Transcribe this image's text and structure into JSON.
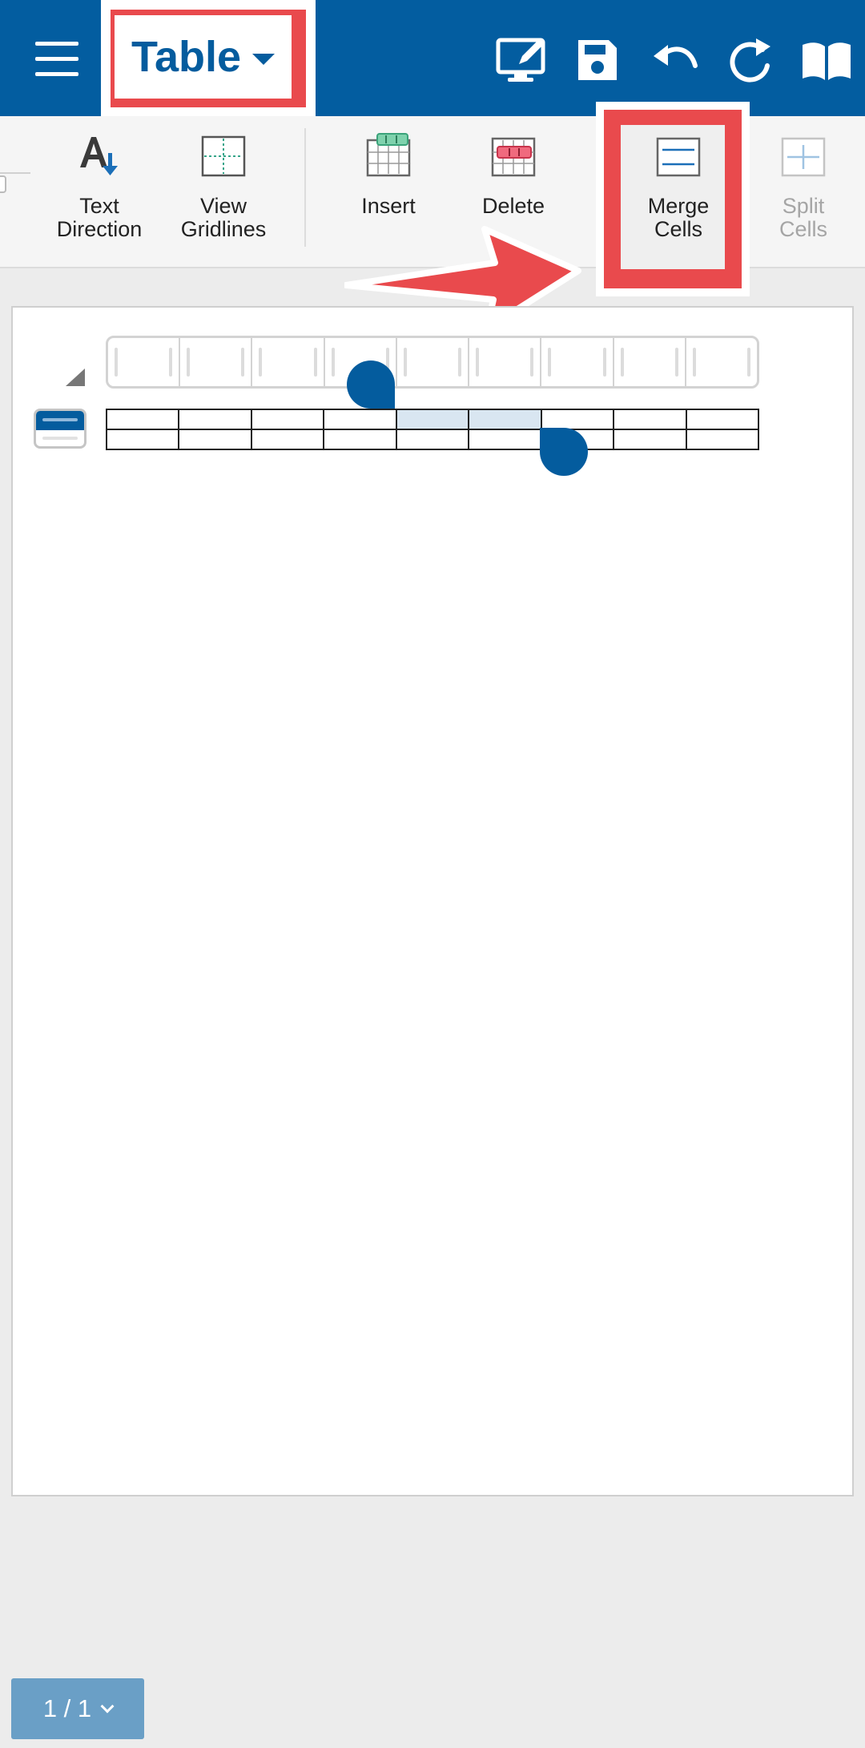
{
  "app_bar": {
    "menu_icon": "hamburger-menu-icon",
    "menu_title": "Table",
    "actions": [
      {
        "name": "present-edit-icon"
      },
      {
        "name": "save-icon"
      },
      {
        "name": "undo-icon"
      },
      {
        "name": "redo-icon"
      },
      {
        "name": "read-mode-icon"
      }
    ]
  },
  "ribbon": {
    "items": [
      {
        "label": "Text\nDirection",
        "icon": "text-direction-icon",
        "enabled": true
      },
      {
        "label": "View\nGridlines",
        "icon": "view-gridlines-icon",
        "enabled": true
      },
      {
        "label": "Insert",
        "icon": "insert-table-icon",
        "enabled": true
      },
      {
        "label": "Delete",
        "icon": "delete-table-icon",
        "enabled": true
      },
      {
        "label": "Merge\nCells",
        "icon": "merge-cells-icon",
        "enabled": true,
        "highlighted": true
      },
      {
        "label": "Split\nCells",
        "icon": "split-cells-icon",
        "enabled": false
      }
    ]
  },
  "document": {
    "table": {
      "columns": 9,
      "rows": 2,
      "selected_row": 0,
      "selected_columns": [
        4,
        5
      ]
    }
  },
  "page_indicator": {
    "text": "1 / 1"
  },
  "colors": {
    "primary": "#035da0",
    "highlight_red": "#e94a4d",
    "selection": "#d9e6f1"
  }
}
